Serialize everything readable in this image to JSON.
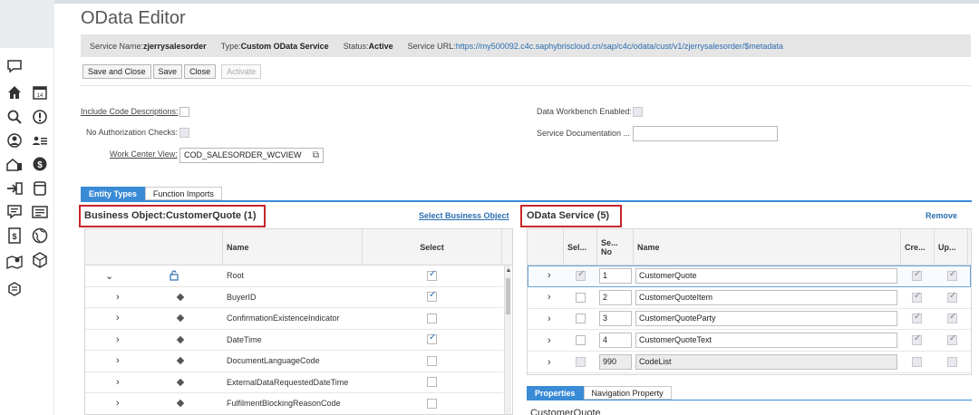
{
  "title": "OData Editor",
  "service_bar": {
    "name_label": "Service Name:",
    "name_value": "zjerrysalesorder",
    "type_label": "Type:",
    "type_value": "Custom OData Service",
    "status_label": "Status:",
    "status_value": "Active",
    "url_label": "Service URL:",
    "url_value": "https://my500092.c4c.saphybriscloud.cn/sap/c4c/odata/cust/v1/zjerrysalesorder/$metadata"
  },
  "toolbar": {
    "save_close": "Save and Close",
    "save": "Save",
    "close": "Close",
    "activate": "Activate"
  },
  "form": {
    "include_code_desc": "Include Code Descriptions:",
    "no_auth": "No Authorization Checks:",
    "wcv_label": "Work Center View:",
    "wcv_value": "COD_SALESORDER_WCVIEW",
    "data_workbench": "Data Workbench Enabled:",
    "service_doc": "Service Documentation ..."
  },
  "tabs": {
    "entity_types": "Entity Types",
    "function_imports": "Function Imports"
  },
  "bo_panel": {
    "heading": "Business Object:CustomerQuote (1)",
    "select_bo_link": "Select Business Object",
    "col_name": "Name",
    "col_select": "Select",
    "rows": [
      {
        "name": "Root",
        "checked": true
      },
      {
        "name": "BuyerID",
        "checked": true
      },
      {
        "name": "ConfirmationExistenceIndicator",
        "checked": false
      },
      {
        "name": "DateTime",
        "checked": true
      },
      {
        "name": "DocumentLanguageCode",
        "checked": false
      },
      {
        "name": "ExternalDataRequestedDateTime",
        "checked": false
      },
      {
        "name": "FulfilmentBlockingReasonCode",
        "checked": false
      }
    ]
  },
  "odata_panel": {
    "heading": "OData Service (5)",
    "remove_link": "Remove",
    "col_select": "Sel...",
    "col_seq_1": "Se...",
    "col_seq_2": "No",
    "col_name": "Name",
    "col_create": "Cre...",
    "col_update": "Up...",
    "rows": [
      {
        "seq": "1",
        "name": "CustomerQuote",
        "sel": true,
        "create": true,
        "update": true
      },
      {
        "seq": "2",
        "name": "CustomerQuoteItem",
        "sel": false,
        "create": true,
        "update": true
      },
      {
        "seq": "3",
        "name": "CustomerQuoteParty",
        "sel": false,
        "create": true,
        "update": true
      },
      {
        "seq": "4",
        "name": "CustomerQuoteText",
        "sel": false,
        "create": true,
        "update": true
      },
      {
        "seq": "990",
        "name": "CodeList",
        "sel": false,
        "create": false,
        "update": false
      }
    ]
  },
  "bottom_tabs": {
    "properties": "Properties",
    "navigation": "Navigation Property"
  },
  "bottom_label": "CustomerQuote"
}
